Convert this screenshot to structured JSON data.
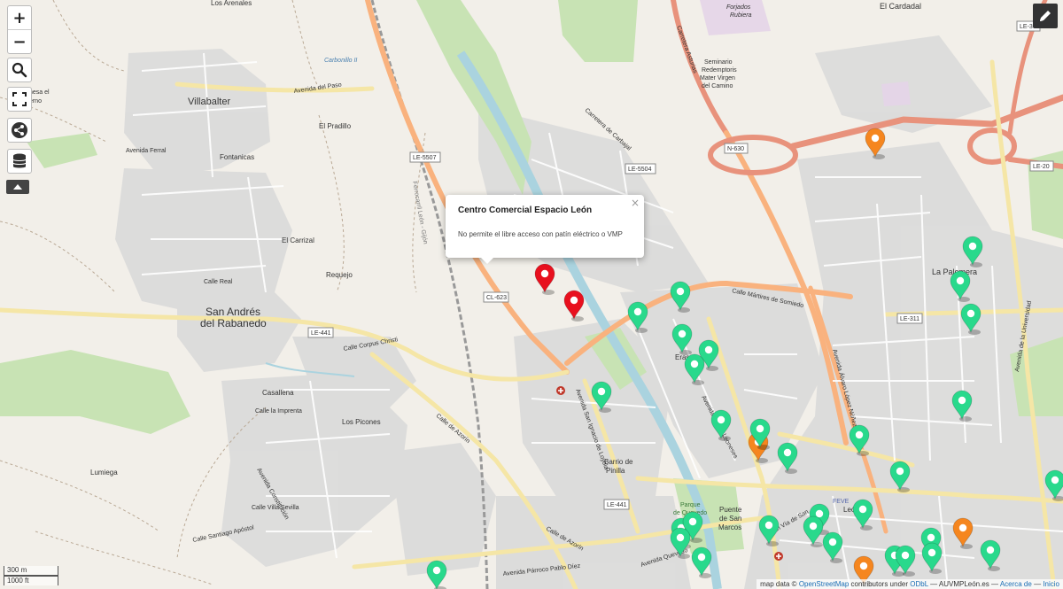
{
  "controls": {
    "zoom_in": "+",
    "zoom_out": "−"
  },
  "popup": {
    "title": "Centro Comercial Espacio León",
    "text": "No permite el libre acceso con patín eléctrico o VMP",
    "close": "×"
  },
  "scale": {
    "metric": "300 m",
    "imperial": "1000 ft"
  },
  "attribution": {
    "prefix": "map data ©",
    "osm": "OpenStreetMap",
    "middle": "contributors under",
    "odbl": "ODbL",
    "sep1": "—",
    "site": "AUVMPLeón.es",
    "sep2": "—",
    "about": "Acerca de",
    "sep3": "—",
    "start": "Inicio"
  },
  "labels": {
    "los_arenales": "Los Arenales",
    "el_cardadal": "El Cardadal",
    "forjados": "Forjados",
    "rubiera": "Rubiera",
    "villabalter": "Villabalter",
    "el_pradillo": "El Pradillo",
    "fontanicas": "Fontanicas",
    "el_carrizal": "El Carrizal",
    "requejo": "Requejo",
    "san_andres_1": "San Andrés",
    "san_andres_2": "del Rabanedo",
    "casallena": "Casallena",
    "los_picones": "Los Picones",
    "lumiega": "Lumiega",
    "seminario_1": "Seminario",
    "seminario_2": "Redemptoris",
    "seminario_3": "Mater Virgen",
    "seminario_4": "del Camino",
    "la_palomera": "La Palomera",
    "eras_de": "Eras de",
    "barrio_1": "Barrio de",
    "barrio_2": "Pinilla",
    "puente_1": "Puente",
    "puente_2": "de San",
    "puente_3": "Marcos",
    "feve": "FEVE",
    "leon": "León",
    "carbonillo": "Carbonillo II",
    "dehesa": "Dehesa el",
    "dehesa2": "Cuerno",
    "parque": "Parque",
    "quevedo": "de Quevedo",
    "avenida_paso": "Avenida del Paso",
    "avenida_azorin": "Calle de Azorín",
    "avenida_azorin2": "Calle de Azorín",
    "corpus": "Calle Corpus Christi",
    "martires": "Calle Mártires de Somiedo",
    "reyes": "Avenida Reyes Leoneses",
    "carretera_carbajal": "Carretera de Carbajal",
    "carretera_asturias": "Carretera Asturias",
    "ignacio": "Avenida San Ignacio de Loyola",
    "alvaro": "Avenida Álvaro López Núñez",
    "pablo_diez": "Avenida Párroco Pablo Díez",
    "quevedo_av": "Avenida Quevedo",
    "universidad": "Avenida de la Universidad",
    "constitucion": "Avenida Constitución",
    "santiago": "Calle Santiago Apóstol",
    "ferrocarril": "Ferrocarril León - Gijón",
    "gran_via": "Gran Vía de San",
    "la_imprenta": "Calle la Imprenta",
    "villa_sevilla": "Calle Villa Sevilla",
    "calle_real": "Calle Real",
    "avenida_ferral": "Avenida Ferral"
  },
  "road_shields": {
    "le5507": "LE-5507",
    "le5504": "LE-5504",
    "cl623": "CL-623",
    "le441a": "LE-441",
    "le441b": "LE-441",
    "n630": "N-630",
    "le311": "LE-311",
    "le20": "LE-20",
    "le3": "LE-3"
  },
  "markers": [
    {
      "color": "#e8101e",
      "name": "marker-red"
    },
    {
      "color": "#e8101e",
      "name": "marker-red"
    },
    {
      "color": "#f5861f",
      "name": "marker-orange"
    },
    {
      "color": "#f5861f",
      "name": "marker-orange"
    },
    {
      "color": "#f5861f",
      "name": "marker-orange"
    },
    {
      "color": "#f5861f",
      "name": "marker-orange"
    },
    {
      "color": "#29d98c",
      "name": "marker-green"
    }
  ],
  "colors": {
    "green_marker": "#29d98c",
    "red_marker": "#e8101e",
    "orange_marker": "#f5861f",
    "motorway": "#e8927c",
    "primary": "#f9b27e",
    "secondary": "#f5e6a6",
    "river": "#aad3df",
    "park": "#c8e3b4",
    "residential": "#d9d9d9"
  },
  "icons": {
    "search": "search-icon",
    "fullscreen": "fullscreen-icon",
    "share": "share-icon",
    "layers": "layers-icon",
    "edit": "pencil-icon",
    "expand": "triangle-up-icon"
  }
}
